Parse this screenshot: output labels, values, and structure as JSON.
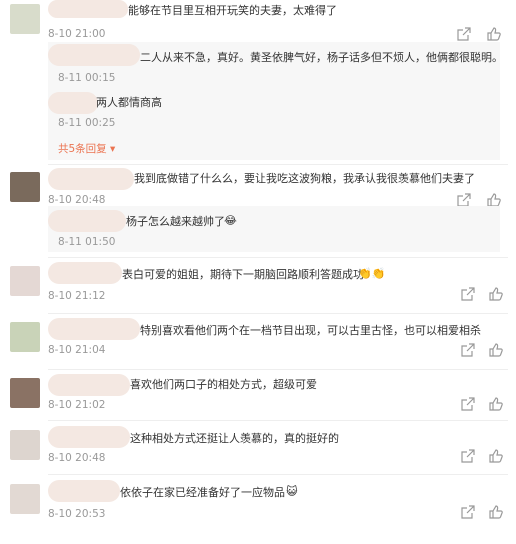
{
  "comments": [
    {
      "text": "能够在节目里互相开玩笑的夫妻，太难得了",
      "time": "8-10 21:00",
      "replies": [
        {
          "text": "二人从来不急，真好。黄圣依脾气好，杨子话多但不烦人，他俩都很聪明。",
          "time": "8-11 00:15"
        },
        {
          "text": "两人都情商高",
          "time": "8-11 00:25"
        }
      ],
      "expand_label": "共5条回复"
    },
    {
      "text": "我到底做错了什么么，要让我吃这波狗粮，我承认我很羡慕他们夫妻了",
      "time": "8-10 20:48",
      "replies": [
        {
          "text": "杨子怎么越来越帅了",
          "time": "8-11 01:50"
        }
      ]
    },
    {
      "text": "表白可爱的姐姐，期待下一期脑回路顺利答题成功",
      "time": "8-10 21:12"
    },
    {
      "text": "特别喜欢看他们两个在一档节目出现，可以古里古怪，也可以相爱相杀",
      "time": "8-10 21:04"
    },
    {
      "text": "喜欢他们两口子的相处方式，超级可爱",
      "time": "8-10 21:02"
    },
    {
      "text": "这种相处方式还挺让人羡慕的，真的挺好的",
      "time": "8-10 20:48"
    },
    {
      "text": "依依子在家已经准备好了一应物品",
      "time": "8-10 20:53"
    }
  ],
  "icons": {
    "share": "share-icon",
    "like": "thumb-up-icon",
    "emoji_laugh": "laughing-emoji-icon",
    "emoji_clap": "clapping-hands-icon",
    "emoji_cat": "cat-emoji-icon"
  },
  "colors": {
    "link": "#eb7350",
    "time": "#999999",
    "reply_bg": "#f7f7f7"
  }
}
